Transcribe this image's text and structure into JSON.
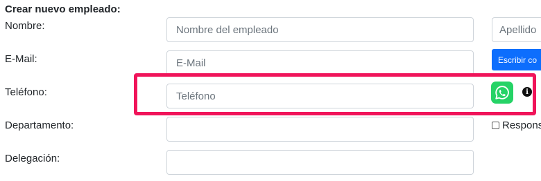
{
  "form": {
    "title": "Crear nuevo empleado:",
    "nombre_label": "Nombre:",
    "nombre_placeholder": "Nombre del empleado",
    "apellido_placeholder": "Apellido",
    "email_label": "E-Mail:",
    "email_placeholder": "E-Mail",
    "email_button_label": "Escribir co",
    "telefono_label": "Teléfono:",
    "telefono_placeholder": "Teléfono",
    "departamento_label": "Departamento:",
    "responsable_label": "Respons",
    "delegacion_label": "Delegación:"
  },
  "icons": {
    "whatsapp": "whatsapp-icon",
    "info": "info-icon"
  },
  "colors": {
    "primary": "#0d6efd",
    "whatsapp": "#25d366",
    "highlight": "#f0145a"
  }
}
